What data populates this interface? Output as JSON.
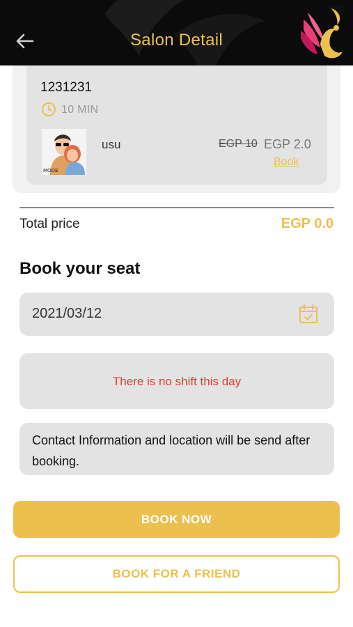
{
  "header": {
    "title": "Salon Detail",
    "back_icon": "arrow-left-icon",
    "logo": "phoenix-logo"
  },
  "service": {
    "name": "1231231",
    "duration": "10 MIN",
    "staff": {
      "name": "usu",
      "avatar_text": "MODE"
    },
    "old_price": "EGP 10",
    "new_price": "EGP 2.0",
    "book_label": "Book"
  },
  "total": {
    "label": "Total price",
    "value": "EGP 0.0"
  },
  "booking": {
    "heading": "Book your seat",
    "date": "2021/03/12",
    "calendar_icon": "calendar-check-icon",
    "no_shift_message": "There is no shift this day",
    "info_message": "Contact Information and location will be send after booking."
  },
  "actions": {
    "book_now": "BOOK NOW",
    "book_for_friend": "BOOK FOR A FRIEND"
  },
  "colors": {
    "accent": "#ecc04f",
    "header_bg": "#0b0b0b",
    "card_bg": "#e3e3e3",
    "error": "#e53935"
  }
}
